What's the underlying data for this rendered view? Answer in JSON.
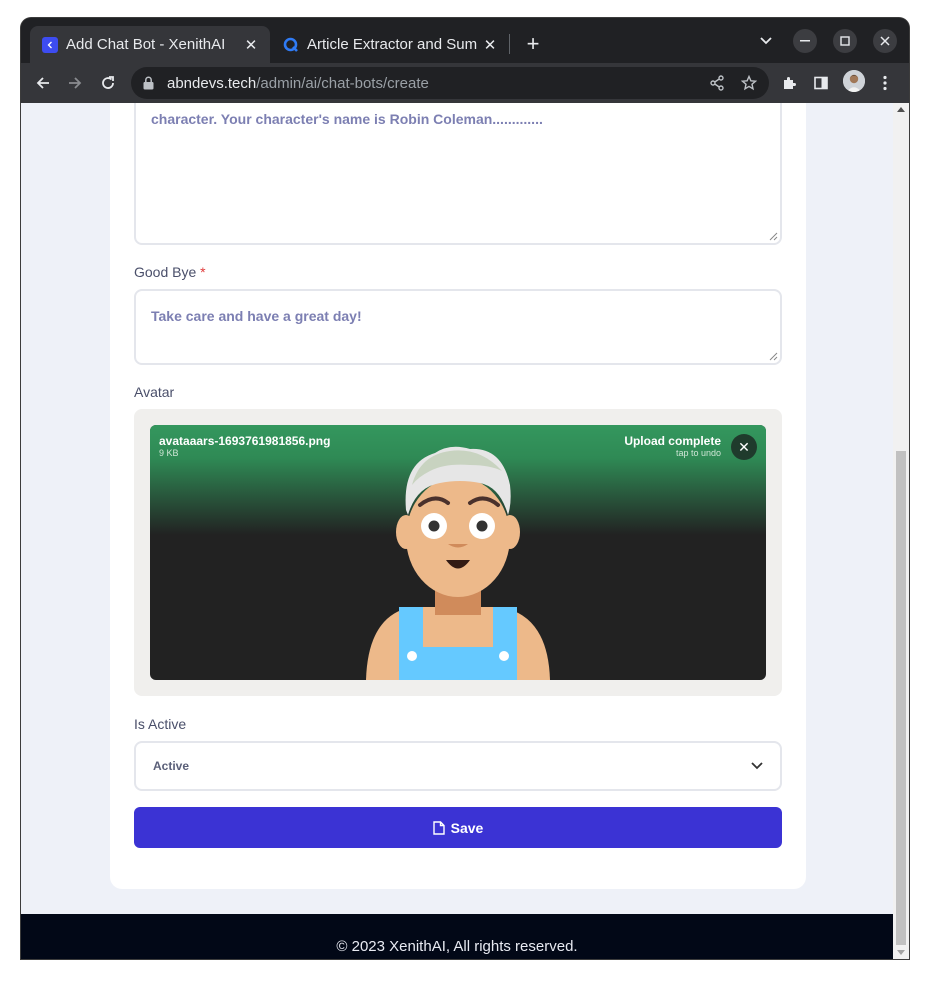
{
  "browser": {
    "tabs": [
      {
        "title": "Add Chat Bot - XenithAI",
        "active": true
      },
      {
        "title": "Article Extractor and Sum",
        "active": false
      }
    ],
    "url_host": "abndevs.tech",
    "url_path": "/admin/ai/chat-bots/create"
  },
  "form": {
    "greeting_text": "character. Your character's name is Robin Coleman.............",
    "goodbye_label": "Good Bye",
    "goodbye_required": "*",
    "goodbye_text": "Take care and have a great day!",
    "avatar_label": "Avatar",
    "avatar_file": {
      "name": "avataaars-1693761981856.png",
      "size": "9 KB",
      "status": "Upload complete",
      "undo_hint": "tap to undo"
    },
    "is_active_label": "Is Active",
    "is_active_value": "Active",
    "save_label": "Save"
  },
  "footer": {
    "copyright": "© 2023 XenithAI, All rights reserved."
  },
  "colors": {
    "primary": "#3b33d4",
    "upload_success": "#34975e",
    "footer_bg": "#020817",
    "page_bg": "#eef1f8"
  }
}
